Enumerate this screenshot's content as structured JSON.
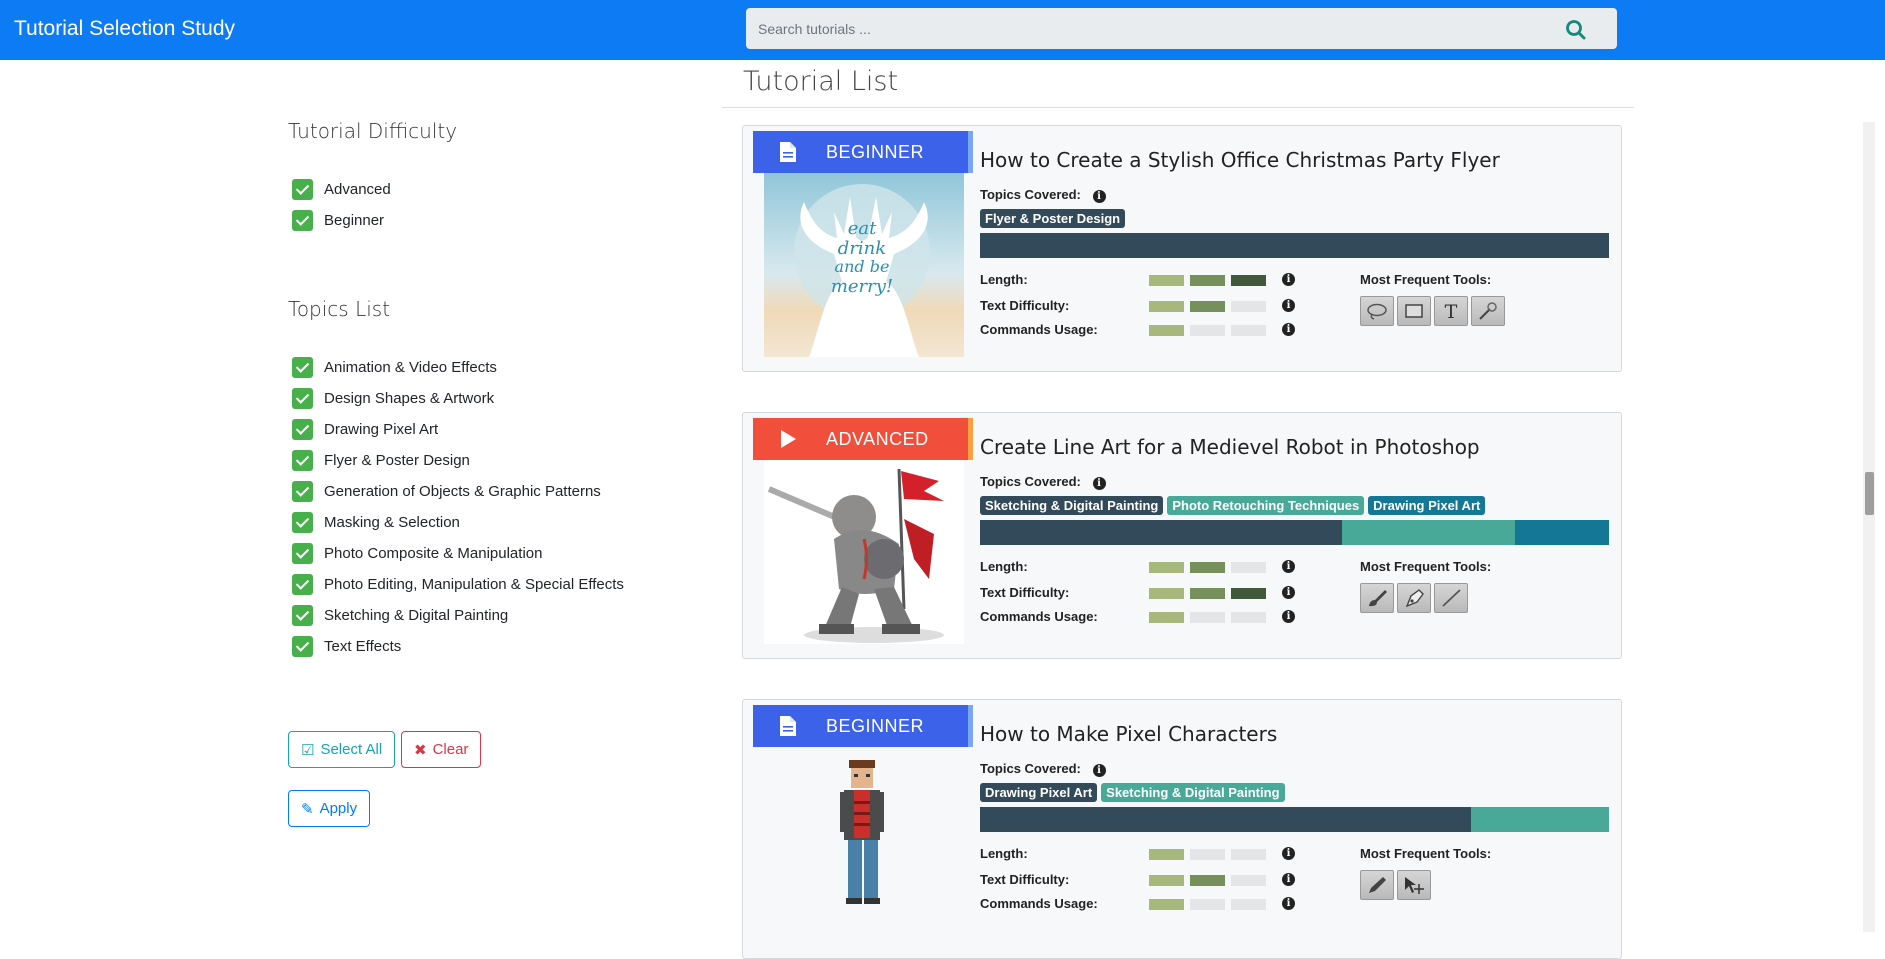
{
  "app": {
    "title": "Tutorial Selection Study"
  },
  "search": {
    "placeholder": "Search tutorials ..."
  },
  "sidebar": {
    "difficulty_heading": "Tutorial Difficulty",
    "difficulty_items": [
      {
        "label": "Advanced",
        "checked": true
      },
      {
        "label": "Beginner",
        "checked": true
      }
    ],
    "topics_heading": "Topics List",
    "topic_items": [
      {
        "label": "Animation & Video Effects",
        "checked": true
      },
      {
        "label": "Design Shapes & Artwork",
        "checked": true
      },
      {
        "label": "Drawing Pixel Art",
        "checked": true
      },
      {
        "label": "Flyer & Poster Design",
        "checked": true
      },
      {
        "label": "Generation of Objects & Graphic Patterns",
        "checked": true
      },
      {
        "label": "Masking & Selection",
        "checked": true
      },
      {
        "label": "Photo Composite & Manipulation",
        "checked": true
      },
      {
        "label": "Photo Editing, Manipulation & Special Effects",
        "checked": true
      },
      {
        "label": "Sketching & Digital Painting",
        "checked": true
      },
      {
        "label": "Text Effects",
        "checked": true
      }
    ],
    "select_all_label": "Select All",
    "clear_label": "Clear",
    "apply_label": "Apply"
  },
  "main": {
    "heading": "Tutorial List",
    "labels": {
      "topics_covered": "Topics Covered:",
      "length": "Length:",
      "text_difficulty": "Text Difficulty:",
      "commands_usage": "Commands Usage:",
      "most_frequent_tools": "Most Frequent Tools:"
    },
    "tutorials": [
      {
        "level": "BEGINNER",
        "media_icon": "document-icon",
        "title": "How to Create a Stylish Office Christmas Party Flyer",
        "topics": [
          {
            "label": "Flyer & Poster Design",
            "color": "#334a5a",
            "share": 1.0
          }
        ],
        "length": 3,
        "text_difficulty": 2,
        "commands_usage": 1,
        "tools": [
          "lasso-tool-icon",
          "rectangle-tool-icon",
          "type-tool-icon",
          "magic-wand-icon"
        ]
      },
      {
        "level": "ADVANCED",
        "media_icon": "play-icon",
        "title": "Create Line Art for a Medievel Robot in Photoshop",
        "topics": [
          {
            "label": "Sketching & Digital Painting",
            "color": "#334a5a",
            "share": 0.575
          },
          {
            "label": "Photo Retouching Techniques",
            "color": "#48a999",
            "share": 0.275
          },
          {
            "label": "Drawing Pixel Art",
            "color": "#147795",
            "share": 0.15
          }
        ],
        "length": 2,
        "text_difficulty": 3,
        "commands_usage": 1,
        "tools": [
          "brush-tool-icon",
          "pen-tool-icon",
          "line-tool-icon"
        ]
      },
      {
        "level": "BEGINNER",
        "media_icon": "document-icon",
        "title": "How to Make Pixel Characters",
        "topics": [
          {
            "label": "Drawing Pixel Art",
            "color": "#334a5a",
            "share": 0.78
          },
          {
            "label": "Sketching & Digital Painting",
            "color": "#48a999",
            "share": 0.22
          }
        ],
        "length": 1,
        "text_difficulty": 2,
        "commands_usage": 1,
        "tools": [
          "pencil-tool-icon",
          "move-tool-icon"
        ]
      }
    ]
  }
}
